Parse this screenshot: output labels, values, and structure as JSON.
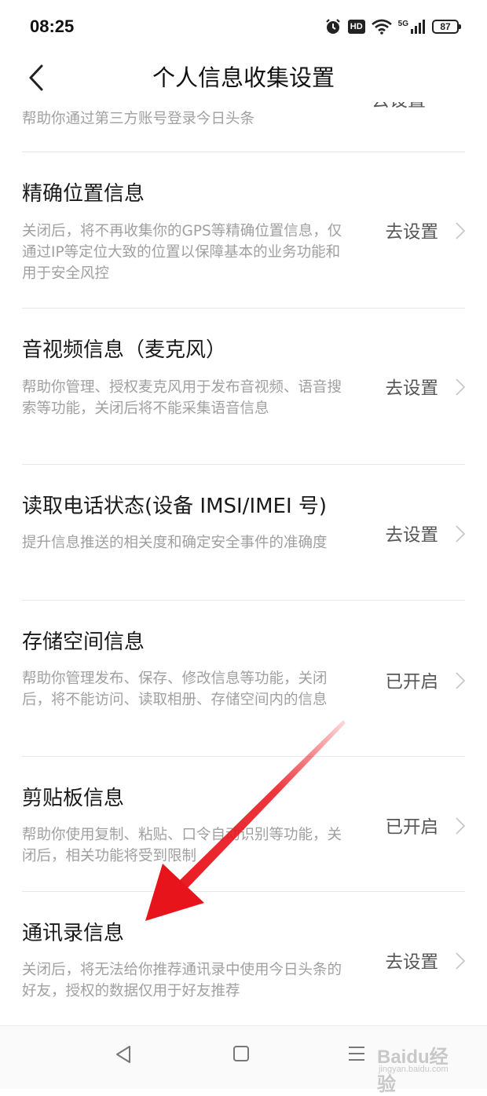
{
  "status_bar": {
    "time": "08:25",
    "icons": [
      "alarm-icon",
      "hd-icon",
      "wifi-icon",
      "5g-signal-icon"
    ],
    "hd_label": "HD",
    "network_label": "5G",
    "battery": "87"
  },
  "header": {
    "back_icon": "chevron-left-icon",
    "title": "个人信息收集设置"
  },
  "partial_item": {
    "description": "帮助你通过第三方账号登录今日头条"
  },
  "items": [
    {
      "title": "精确位置信息",
      "description": "关闭后，将不再收集你的GPS等精确位置信息，仅通过IP等定位大致的位置以保障基本的业务功能和用于安全风控",
      "action": "去设置"
    },
    {
      "title": "音视频信息（麦克风）",
      "description": "帮助你管理、授权麦克风用于发布音视频、语音搜索等功能，关闭后将不能采集语音信息",
      "action": "去设置"
    },
    {
      "title": "读取电话状态(设备 IMSI/IMEI 号)",
      "description": "提升信息推送的相关度和确定安全事件的准确度",
      "action": "去设置"
    },
    {
      "title": "存储空间信息",
      "description": "帮助你管理发布、保存、修改信息等功能，关闭后，将不能访问、读取相册、存储空间内的信息",
      "action": "已开启"
    },
    {
      "title": "剪贴板信息",
      "description": "帮助你使用复制、粘贴、口令自动识别等功能，关闭后，相关功能将受到限制",
      "action": "已开启"
    },
    {
      "title": "通讯录信息",
      "description": "关闭后，将无法给你推荐通讯录中使用今日头条的好友，授权的数据仅用于好友推荐",
      "action": "去设置"
    }
  ],
  "system_nav": {
    "icons": [
      "back-triangle-icon",
      "home-square-icon",
      "menu-lines-icon"
    ]
  },
  "annotation": {
    "arrow_color": "#e8141b"
  },
  "watermark": {
    "main": "Baidu经验",
    "sub": "jingyan.baidu.com"
  }
}
